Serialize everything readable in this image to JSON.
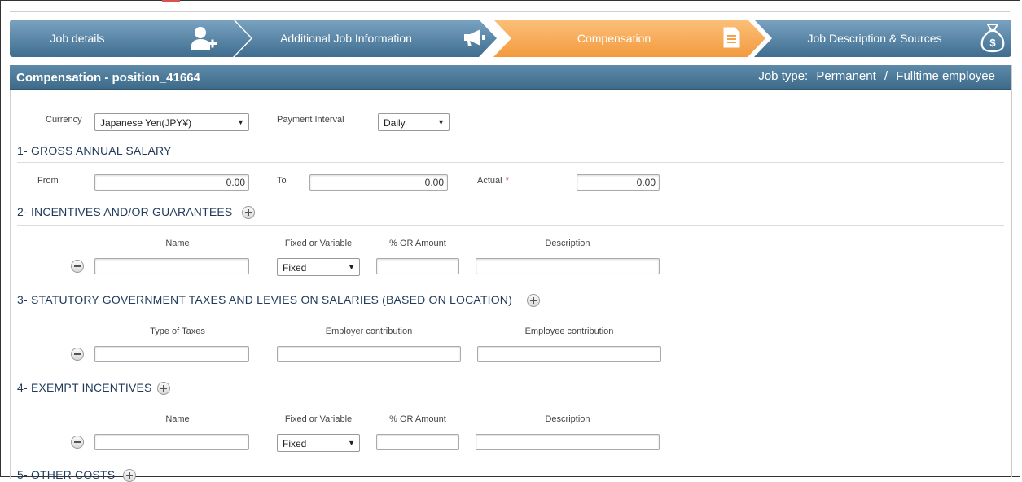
{
  "wizard": {
    "steps": [
      {
        "label": "Job details",
        "icon": "add-user-icon",
        "state": "done"
      },
      {
        "label": "Additional Job Information",
        "icon": "megaphone-icon",
        "state": "done"
      },
      {
        "label": "Compensation",
        "icon": "document-icon",
        "state": "active"
      },
      {
        "label": "Job Description & Sources",
        "icon": "money-bag-icon",
        "state": "pending"
      }
    ],
    "colors": {
      "done": "#4f7fa3",
      "active": "#f7a04a"
    }
  },
  "panel": {
    "title": "Compensation - position_41664",
    "job_type_label": "Job type:",
    "job_type_value1": "Permanent",
    "job_type_sep": "/",
    "job_type_value2": "Fulltime employee"
  },
  "currency": {
    "label": "Currency",
    "value": "Japanese Yen(JPY¥)"
  },
  "payment_interval": {
    "label": "Payment Interval",
    "value": "Daily"
  },
  "section1": {
    "title": "1- GROSS ANNUAL SALARY",
    "from_label": "From",
    "from_value": "0.00",
    "to_label": "To",
    "to_value": "0.00",
    "actual_label": "Actual",
    "required_mark": "*",
    "actual_value": "0.00"
  },
  "section2": {
    "title": "2- INCENTIVES AND/OR GUARANTEES",
    "col_name": "Name",
    "col_fixed": "Fixed or Variable",
    "col_amount": "% OR Amount",
    "col_desc": "Description",
    "row": {
      "name": "",
      "fixed": "Fixed",
      "amount": "",
      "description": ""
    }
  },
  "section3": {
    "title": "3- STATUTORY GOVERNMENT TAXES AND LEVIES ON SALARIES (BASED ON LOCATION)",
    "col_type": "Type of Taxes",
    "col_employer": "Employer contribution",
    "col_employee": "Employee contribution",
    "row": {
      "type": "",
      "employer": "",
      "employee": ""
    }
  },
  "section4": {
    "title": "4- EXEMPT INCENTIVES",
    "col_name": "Name",
    "col_fixed": "Fixed or Variable",
    "col_amount": "% OR Amount",
    "col_desc": "Description",
    "row": {
      "name": "",
      "fixed": "Fixed",
      "amount": "",
      "description": ""
    }
  },
  "section5": {
    "title": "5- OTHER COSTS"
  }
}
